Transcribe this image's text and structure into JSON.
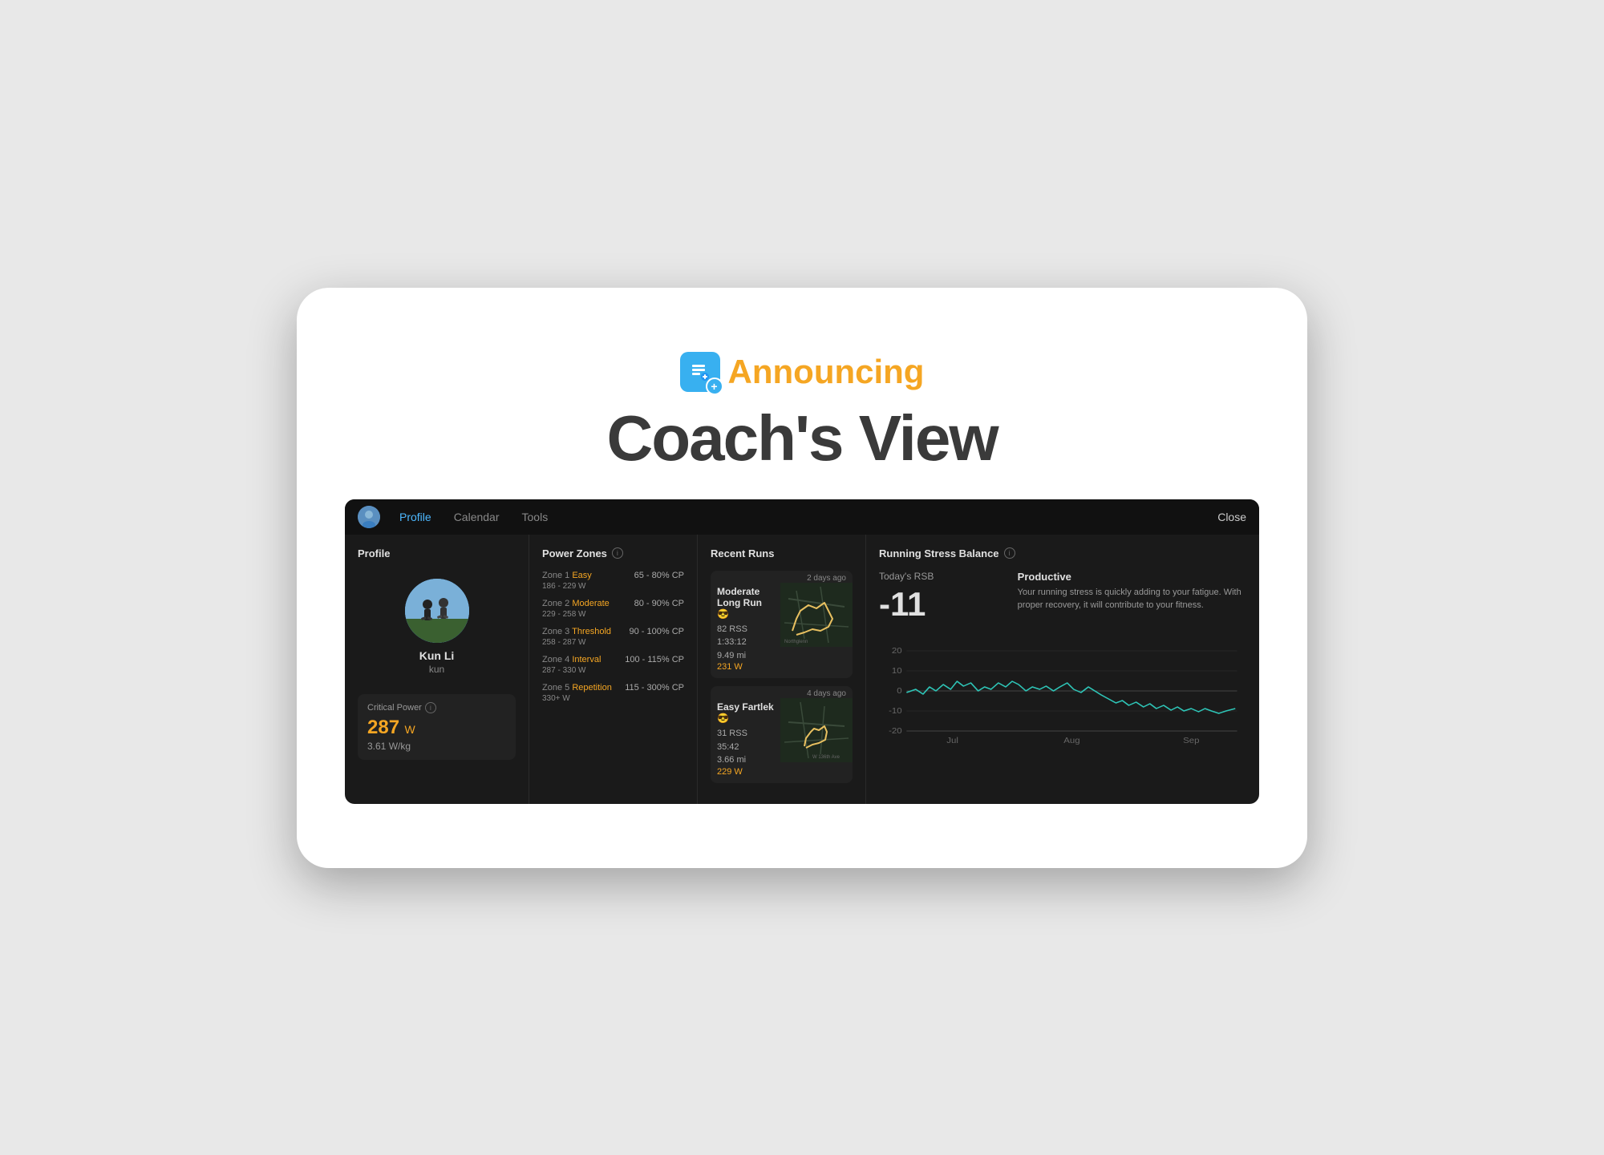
{
  "announcement": {
    "announcing_label": "Announcing",
    "title": "Coach's View"
  },
  "nav": {
    "profile_label": "Profile",
    "calendar_label": "Calendar",
    "tools_label": "Tools",
    "close_label": "Close"
  },
  "profile_panel": {
    "title": "Profile",
    "name": "Kun Li",
    "username": "kun",
    "cp_label": "Critical Power",
    "cp_value": "287",
    "cp_unit": "W",
    "cp_kg": "3.61 W/kg"
  },
  "power_zones": {
    "title": "Power Zones",
    "zones": [
      {
        "number": "1",
        "name": "Easy",
        "color": "#f5a623",
        "range_w": "186 - 229 W",
        "cp_range": "65 - 80% CP"
      },
      {
        "number": "2",
        "name": "Moderate",
        "color": "#f5a623",
        "range_w": "229 - 258 W",
        "cp_range": "80 - 90% CP"
      },
      {
        "number": "3",
        "name": "Threshold",
        "color": "#f5a623",
        "range_w": "258 - 287 W",
        "cp_range": "90 - 100% CP"
      },
      {
        "number": "4",
        "name": "Interval",
        "color": "#f5a623",
        "range_w": "287 - 330 W",
        "cp_range": "100 - 115% CP"
      },
      {
        "number": "5",
        "name": "Repetition",
        "color": "#f5a623",
        "range_w": "330+ W",
        "cp_range": "115 - 300% CP"
      }
    ]
  },
  "recent_runs": {
    "title": "Recent Runs",
    "runs": [
      {
        "title": "Moderate Long Run 😎",
        "timestamp": "2 days ago",
        "rss": "82 RSS",
        "time": "1:33:12",
        "distance": "9.49 mi",
        "watts": "231 W",
        "watts_color": "#f5a623"
      },
      {
        "title": "Easy Fartlek 😎",
        "timestamp": "4 days ago",
        "rss": "31 RSS",
        "time": "35:42",
        "distance": "3.66 mi",
        "watts": "229 W",
        "watts_color": "#f5a623"
      }
    ]
  },
  "rsb": {
    "title": "Running Stress Balance",
    "today_label": "Today's RSB",
    "today_value": "-11",
    "status_label": "Productive",
    "description": "Your running stress is quickly adding to your fatigue. With proper recovery, it will contribute to your fitness.",
    "chart": {
      "x_labels": [
        "Jul",
        "Aug",
        "Sep"
      ],
      "y_labels": [
        "20",
        "10",
        "0",
        "-10",
        "-20"
      ],
      "line_color": "#2ec4b6"
    }
  }
}
